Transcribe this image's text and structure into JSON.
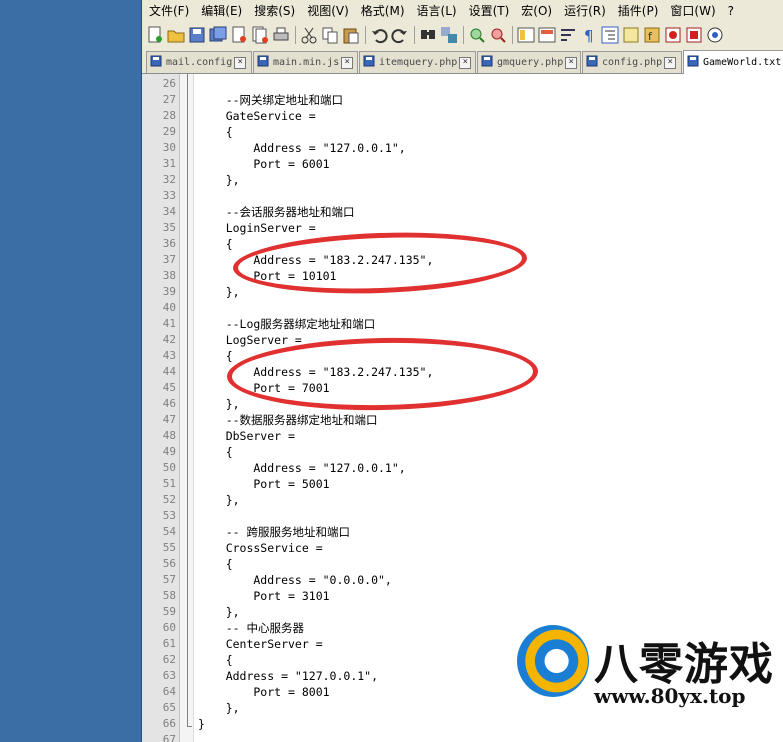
{
  "menubar": {
    "items": [
      "文件(F)",
      "编辑(E)",
      "搜索(S)",
      "视图(V)",
      "格式(M)",
      "语言(L)",
      "设置(T)",
      "宏(O)",
      "运行(R)",
      "插件(P)",
      "窗口(W)",
      "?"
    ]
  },
  "toolbar": {
    "buttons": [
      "new-file-icon",
      "open-folder-icon",
      "save-icon",
      "save-all-icon",
      "close-icon",
      "close-all-icon",
      "print-icon",
      "cut-icon",
      "copy-icon",
      "paste-icon",
      "undo-icon",
      "redo-icon",
      "find-icon",
      "replace-icon",
      "zoom-in-icon",
      "zoom-out-icon",
      "sync-vertical-icon",
      "sync-horizontal-icon",
      "word-wrap-icon",
      "show-all-chars-icon",
      "indent-guide-icon",
      "doc-map-icon",
      "function-list-icon",
      "record-macro-icon",
      "stop-macro-icon",
      "play-macro-icon"
    ]
  },
  "tabs": [
    {
      "label": "mail.config",
      "active": false
    },
    {
      "label": "main.min.js",
      "active": false
    },
    {
      "label": "itemquery.php",
      "active": false
    },
    {
      "label": "gmquery.php",
      "active": false
    },
    {
      "label": "config.php",
      "active": false
    },
    {
      "label": "GameWorld.txt",
      "active": true
    }
  ],
  "editor": {
    "lines": [
      {
        "num": "26",
        "text": ""
      },
      {
        "num": "27",
        "text": "    --网关绑定地址和端口"
      },
      {
        "num": "28",
        "text": "    GateService ="
      },
      {
        "num": "29",
        "text": "    {"
      },
      {
        "num": "30",
        "text": "        Address = \"127.0.0.1\","
      },
      {
        "num": "31",
        "text": "        Port = 6001"
      },
      {
        "num": "32",
        "text": "    },"
      },
      {
        "num": "33",
        "text": ""
      },
      {
        "num": "34",
        "text": "    --会话服务器地址和端口"
      },
      {
        "num": "35",
        "text": "    LoginServer ="
      },
      {
        "num": "36",
        "text": "    {"
      },
      {
        "num": "37",
        "text": "        Address = \"183.2.247.135\","
      },
      {
        "num": "38",
        "text": "        Port = 10101"
      },
      {
        "num": "39",
        "text": "    },"
      },
      {
        "num": "40",
        "text": ""
      },
      {
        "num": "41",
        "text": "    --Log服务器绑定地址和端口"
      },
      {
        "num": "42",
        "text": "    LogServer ="
      },
      {
        "num": "43",
        "text": "    {"
      },
      {
        "num": "44",
        "text": "        Address = \"183.2.247.135\","
      },
      {
        "num": "45",
        "text": "        Port = 7001"
      },
      {
        "num": "46",
        "text": "    },"
      },
      {
        "num": "47",
        "text": "    --数据服务器绑定地址和端口"
      },
      {
        "num": "48",
        "text": "    DbServer ="
      },
      {
        "num": "49",
        "text": "    {"
      },
      {
        "num": "50",
        "text": "        Address = \"127.0.0.1\","
      },
      {
        "num": "51",
        "text": "        Port = 5001"
      },
      {
        "num": "52",
        "text": "    },"
      },
      {
        "num": "53",
        "text": ""
      },
      {
        "num": "54",
        "text": "    -- 跨服服务地址和端口"
      },
      {
        "num": "55",
        "text": "    CrossService ="
      },
      {
        "num": "56",
        "text": "    {"
      },
      {
        "num": "57",
        "text": "        Address = \"0.0.0.0\","
      },
      {
        "num": "58",
        "text": "        Port = 3101"
      },
      {
        "num": "59",
        "text": "    },"
      },
      {
        "num": "60",
        "text": "    -- 中心服务器"
      },
      {
        "num": "61",
        "text": "    CenterServer ="
      },
      {
        "num": "62",
        "text": "    {"
      },
      {
        "num": "63",
        "text": "    Address = \"127.0.0.1\","
      },
      {
        "num": "64",
        "text": "        Port = 8001"
      },
      {
        "num": "65",
        "text": "    },"
      },
      {
        "num": "66",
        "text": "}"
      },
      {
        "num": "67",
        "text": ""
      }
    ]
  },
  "annotations": {
    "color": "#e03030",
    "highlighted_lines": [
      "37",
      "38",
      "44",
      "45"
    ]
  },
  "watermark": {
    "brand": "八零游戏",
    "url": "www.80yx.top"
  }
}
